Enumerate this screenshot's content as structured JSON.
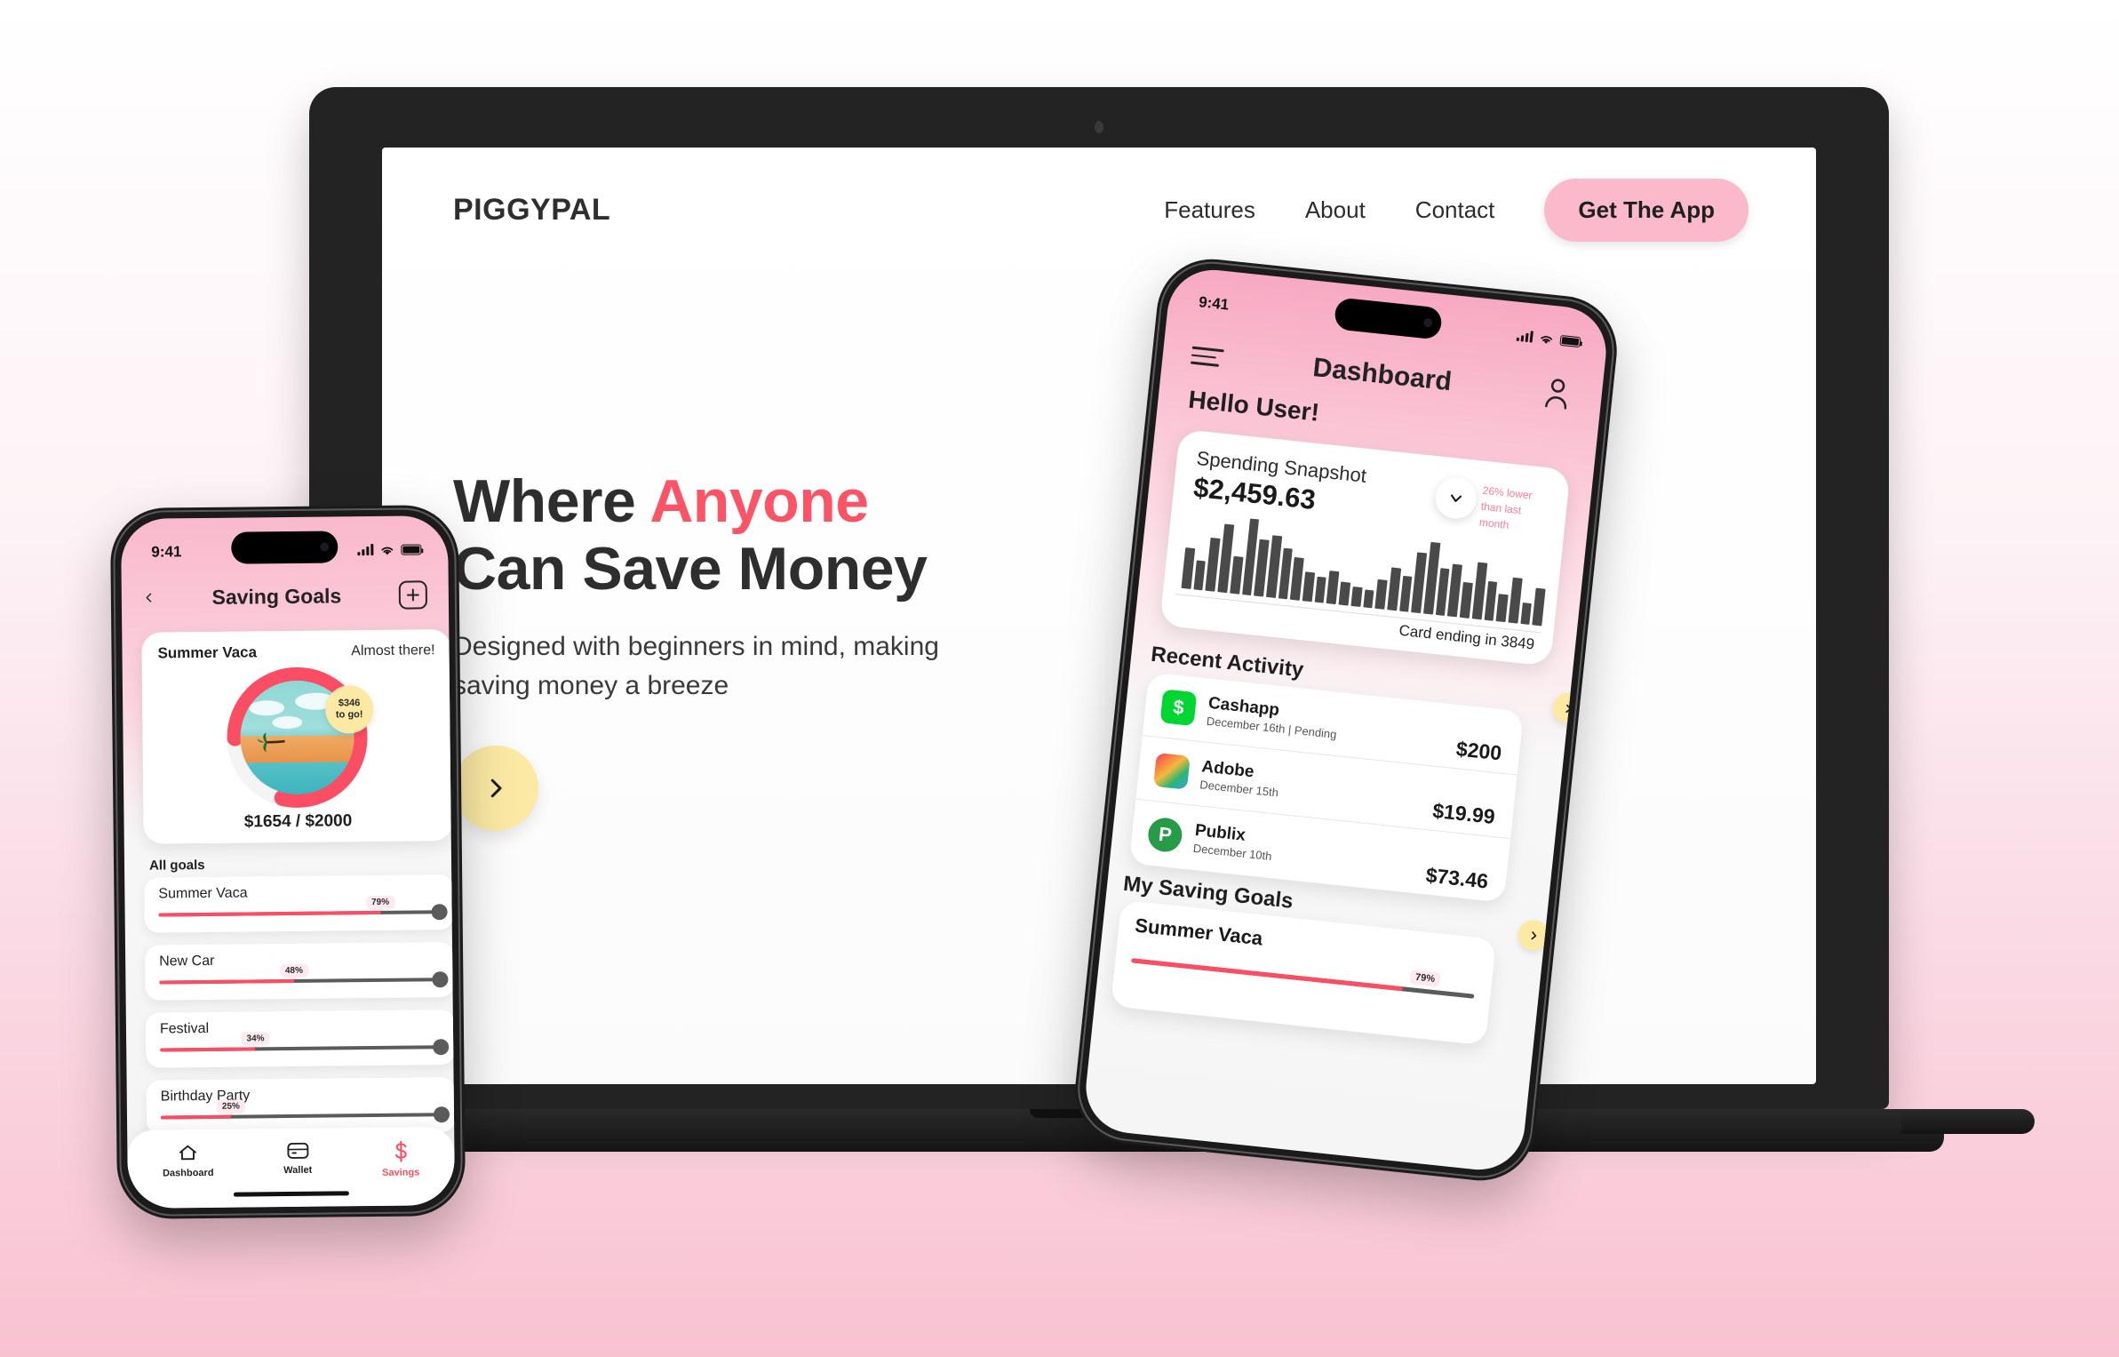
{
  "theme": {
    "accent_pink": "#fb5467",
    "soft_pink": "#fbbacb",
    "blob_pink": "#fbc8da",
    "yellow": "#fbe9a4",
    "dark": "#232323"
  },
  "site": {
    "logo": "PIGGYPAL",
    "nav": [
      {
        "label": "Features"
      },
      {
        "label": "About"
      },
      {
        "label": "Contact"
      }
    ],
    "cta_label": "Get The App"
  },
  "hero": {
    "headline_part1": "Where ",
    "headline_accent": "Anyone",
    "headline_part2": "Can Save Money",
    "subtext": "Designed with beginners in mind, making saving money a breeze",
    "cta_icon": "chevron-right-icon"
  },
  "phone_left": {
    "status": {
      "time": "9:41",
      "signal": "signal-icon",
      "wifi": "wifi-icon",
      "battery": "battery-icon"
    },
    "nav": {
      "back_icon": "chevron-left-icon",
      "title": "Saving Goals",
      "add_icon": "plus-icon"
    },
    "featured": {
      "title": "Summer Vaca",
      "status": "Almost there!",
      "badge_line1": "$346",
      "badge_line2": "to go!",
      "amount": "$1654 / $2000",
      "progress_pct": 79
    },
    "all_goals_label": "All goals",
    "goals": [
      {
        "name": "Summer Vaca",
        "pct_label": "79%",
        "pct": 79
      },
      {
        "name": "New Car",
        "pct_label": "48%",
        "pct": 48
      },
      {
        "name": "Festival",
        "pct_label": "34%",
        "pct": 34
      },
      {
        "name": "Birthday Party",
        "pct_label": "25%",
        "pct": 25
      }
    ],
    "tabs": [
      {
        "label": "Dashboard",
        "icon": "home-icon",
        "active": false
      },
      {
        "label": "Wallet",
        "icon": "card-icon",
        "active": false
      },
      {
        "label": "Savings",
        "icon": "dollar-icon",
        "active": true
      }
    ]
  },
  "phone_right": {
    "status": {
      "time": "9:41",
      "signal": "signal-icon",
      "wifi": "wifi-icon",
      "battery": "battery-icon"
    },
    "nav": {
      "menu_icon": "hamburger-icon",
      "title": "Dashboard",
      "profile_icon": "user-icon"
    },
    "greeting": "Hello User!",
    "snapshot": {
      "label": "Spending Snapshot",
      "amount": "$2,459.63",
      "note": "26% lower than last month",
      "expand_icon": "chevron-down-icon",
      "footer": "Card ending in 3849"
    },
    "recent_activity_label": "Recent Activity",
    "transactions": [
      {
        "name": "Cashapp",
        "meta": "December 16th | Pending",
        "amount": "$200",
        "logo": "cashapp-logo"
      },
      {
        "name": "Adobe",
        "meta": "December 15th",
        "amount": "$19.99",
        "logo": "adobe-logo"
      },
      {
        "name": "Publix",
        "meta": "December 10th",
        "amount": "$73.46",
        "logo": "publix-logo"
      }
    ],
    "saving_goals_label": "My Saving Goals",
    "goal_preview": {
      "name": "Summer Vaca",
      "pct_label": "79%"
    }
  },
  "chart_data": {
    "type": "bar",
    "title": "Spending Snapshot",
    "values": [
      42,
      30,
      55,
      70,
      38,
      78,
      58,
      64,
      52,
      44,
      30,
      26,
      34,
      24,
      20,
      18,
      30,
      44,
      36,
      62,
      74,
      48,
      54,
      36,
      58,
      40,
      28,
      46,
      22,
      38
    ],
    "xlabel": "",
    "ylabel": "",
    "ylim": [
      0,
      80
    ],
    "grid": false
  }
}
